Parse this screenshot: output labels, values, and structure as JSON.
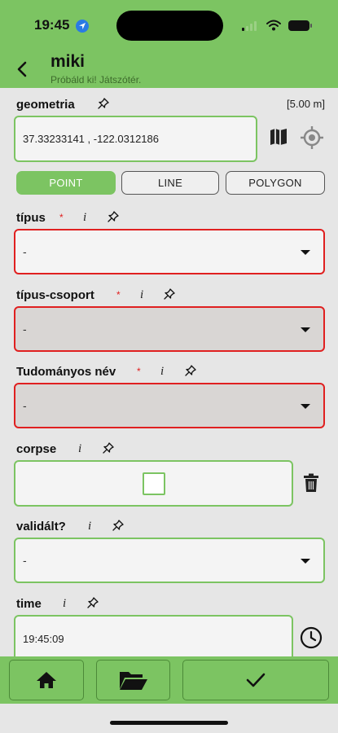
{
  "status": {
    "time": "19:45"
  },
  "header": {
    "title": "miki",
    "subtitle": "Próbáld ki! Játszótér."
  },
  "geometry": {
    "label": "geometria",
    "scale": "[5.00 m]",
    "value": "37.33233141 , -122.0312186",
    "modes": [
      "POINT",
      "LINE",
      "POLYGON"
    ],
    "active_mode": "POINT"
  },
  "fields": {
    "tipus": {
      "label": "típus",
      "required": "*",
      "info": "i",
      "value": "-"
    },
    "tipus_csoport": {
      "label": "típus-csoport",
      "required": "*",
      "info": "i",
      "value": "-"
    },
    "tudomanyos_nev": {
      "label": "Tudományos név",
      "required": "*",
      "info": "i",
      "value": "-"
    },
    "corpse": {
      "label": "corpse",
      "info": "i",
      "checked": false
    },
    "validalt": {
      "label": "validált?",
      "info": "i",
      "value": "-"
    },
    "time": {
      "label": "time",
      "info": "i",
      "value": "19:45:09"
    }
  },
  "icons": {
    "back": "chevron-left-icon",
    "pin": "pin-icon",
    "map": "map-icon",
    "locate": "crosshair-icon",
    "trash": "trash-icon",
    "clock": "clock-icon",
    "home": "home-icon",
    "folder": "folder-open-icon",
    "confirm": "checkmark-icon"
  },
  "colors": {
    "accent": "#7cc462",
    "required": "#e02020",
    "background": "#e6e6e6"
  }
}
